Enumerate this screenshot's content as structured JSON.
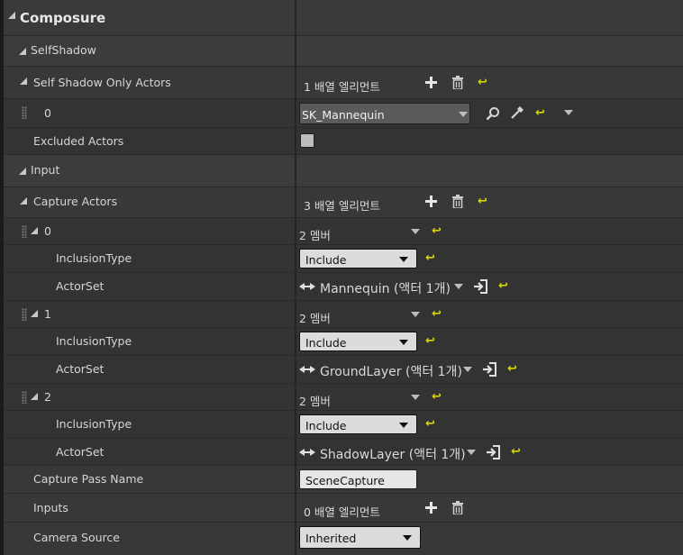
{
  "header": {
    "title": "Composure"
  },
  "self_shadow": {
    "category_label": "SelfShadow",
    "only_actors": {
      "label": "Self Shadow Only Actors",
      "count_text": "1 배열 엘리먼트"
    },
    "element0": {
      "index": "0",
      "asset_value": "SK_Mannequin"
    },
    "excluded": {
      "label": "Excluded Actors",
      "checked": false
    }
  },
  "input": {
    "category_label": "Input",
    "capture_actors": {
      "label": "Capture Actors",
      "count_text": "3 배열 엘리먼트"
    },
    "elements": [
      {
        "index": "0",
        "member_text": "2 멤버",
        "inclusion_label": "InclusionType",
        "inclusion_value": "Include",
        "actorset_label": "ActorSet",
        "actorset_value": "Mannequin (액터 1개)"
      },
      {
        "index": "1",
        "member_text": "2 멤버",
        "inclusion_label": "InclusionType",
        "inclusion_value": "Include",
        "actorset_label": "ActorSet",
        "actorset_value": "GroundLayer (액터 1개)"
      },
      {
        "index": "2",
        "member_text": "2 멤버",
        "inclusion_label": "InclusionType",
        "inclusion_value": "Include",
        "actorset_label": "ActorSet",
        "actorset_value": "ShadowLayer (액터 1개)"
      }
    ],
    "capture_pass_name": {
      "label": "Capture Pass Name",
      "value": "SceneCapture"
    },
    "inputs": {
      "label": "Inputs",
      "count_text": "0 배열 엘리먼트"
    },
    "camera_source": {
      "label": "Camera Source",
      "value": "Inherited"
    }
  },
  "colors": {
    "reset_arrow": "#d7d800",
    "panel_bg": "#333333",
    "category_bg": "#3c3c3c"
  },
  "icons": [
    "expand-triangle-icon",
    "plus-icon",
    "trash-icon",
    "reset-to-default-icon",
    "search-icon",
    "eyedropper-icon",
    "chevron-down-icon",
    "drag-grip-icon",
    "actor-link-icon",
    "enter-icon"
  ]
}
